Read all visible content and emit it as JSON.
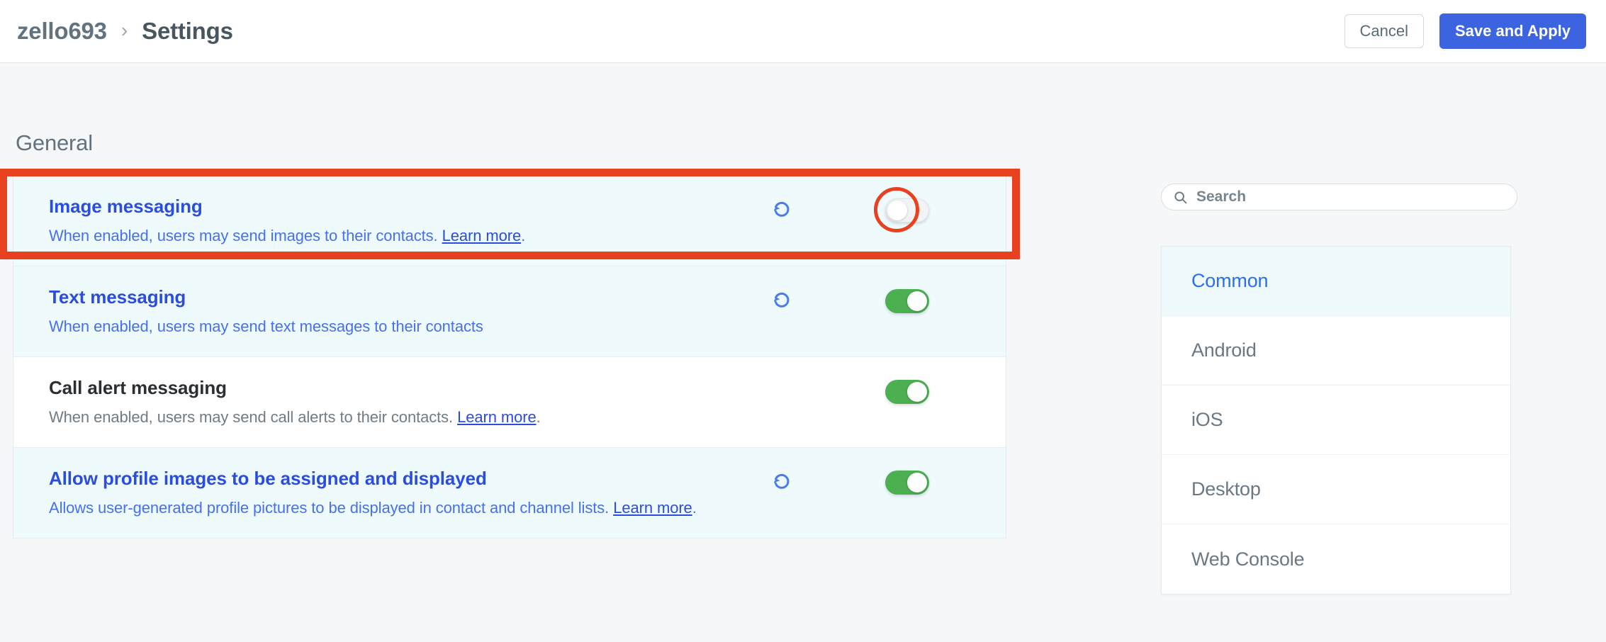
{
  "header": {
    "org_name": "zello693",
    "separator": "›",
    "page_title": "Settings",
    "cancel_label": "Cancel",
    "save_label": "Save and Apply"
  },
  "section": {
    "title": "General"
  },
  "settings": [
    {
      "title": "Image messaging",
      "desc_prefix": "When enabled, users may send images to their contacts. ",
      "link_label": "Learn more",
      "desc_suffix": ".",
      "modified": true,
      "has_revert": true,
      "toggle_state": "off",
      "highlighted": true
    },
    {
      "title": "Text messaging",
      "desc_prefix": "When enabled, users may send text messages to their contacts",
      "link_label": "",
      "desc_suffix": "",
      "modified": true,
      "has_revert": true,
      "toggle_state": "on",
      "highlighted": false
    },
    {
      "title": "Call alert messaging",
      "desc_prefix": "When enabled, users may send call alerts to their contacts. ",
      "link_label": "Learn more",
      "desc_suffix": ".",
      "modified": false,
      "has_revert": false,
      "toggle_state": "on",
      "highlighted": false
    },
    {
      "title": "Allow profile images to be assigned and displayed",
      "desc_prefix": "Allows user-generated profile pictures to be displayed in contact and channel lists. ",
      "link_label": "Learn more",
      "desc_suffix": ".",
      "modified": true,
      "has_revert": true,
      "toggle_state": "on",
      "highlighted": false
    }
  ],
  "search": {
    "placeholder": "Search",
    "value": "",
    "icon": "search-icon"
  },
  "categories": [
    {
      "label": "Common",
      "active": true
    },
    {
      "label": "Android",
      "active": false
    },
    {
      "label": "iOS",
      "active": false
    },
    {
      "label": "Desktop",
      "active": false
    },
    {
      "label": "Web Console",
      "active": false
    }
  ],
  "colors": {
    "accent_blue": "#3c64e0",
    "link_blue": "#2b4ddf",
    "toggle_on_green": "#4caf50",
    "highlight_red": "#e8411f",
    "modified_row_bg": "#effafd"
  },
  "icons": {
    "revert": "revert-icon",
    "chevron_right": "chevron-right-icon"
  }
}
